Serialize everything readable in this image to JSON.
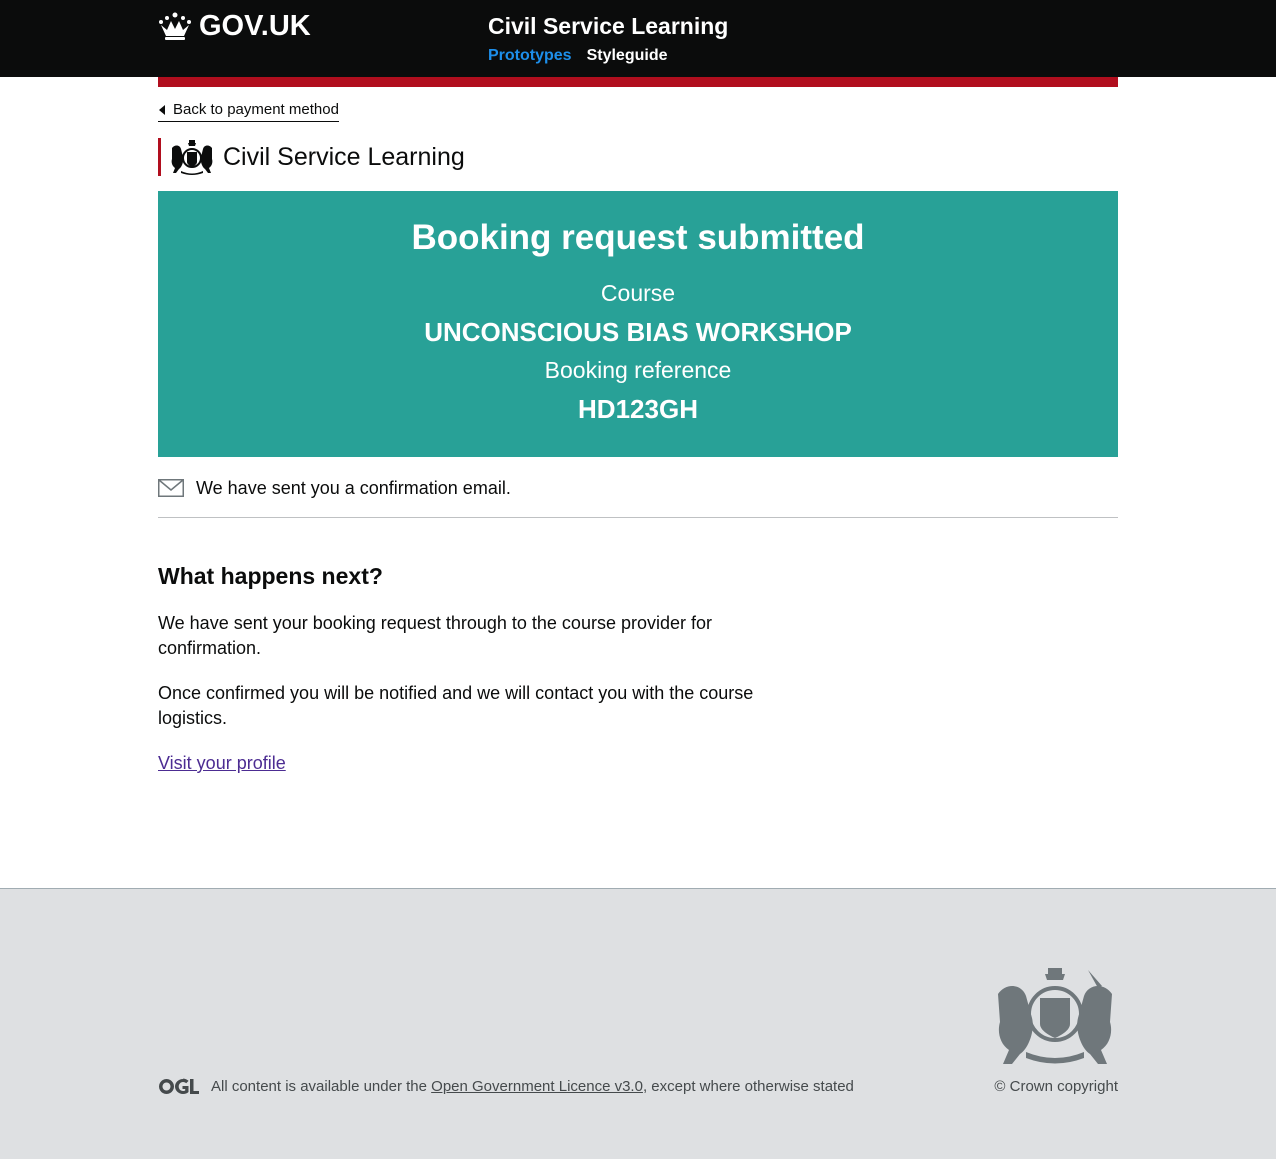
{
  "header": {
    "logo_text": "GOV.UK",
    "service_name": "Civil Service Learning",
    "nav": [
      {
        "label": "Prototypes",
        "active": true
      },
      {
        "label": "Styleguide",
        "active": false
      }
    ]
  },
  "back_link": {
    "label": "Back to payment method"
  },
  "organisation": {
    "name": "Civil Service Learning"
  },
  "panel": {
    "title": "Booking request submitted",
    "course_label": "Course",
    "course_value": "UNCONSCIOUS BIAS WORKSHOP",
    "reference_label": "Booking reference",
    "reference_value": "HD123GH"
  },
  "email_notice": {
    "text": "We have sent you a confirmation email.",
    "icon": "envelope-icon"
  },
  "next_steps": {
    "heading": "What happens next?",
    "paragraph_1": "We have sent your booking request through to the course provider for confirmation.",
    "paragraph_2": "Once confirmed you will be notified and we will contact you with the course logistics.",
    "profile_link": "Visit your profile"
  },
  "footer": {
    "licence_prefix": "All content is available under the",
    "licence_link": "Open Government Licence v3.0",
    "licence_suffix": ", except where otherwise stated",
    "copyright": "© Crown copyright"
  },
  "colors": {
    "header_bg": "#0b0c0c",
    "brand_red": "#b10e1e",
    "panel_turquoise": "#28a197",
    "nav_active": "#1d8feb",
    "link_visited": "#4c2c92",
    "footer_bg": "#dee0e2"
  }
}
